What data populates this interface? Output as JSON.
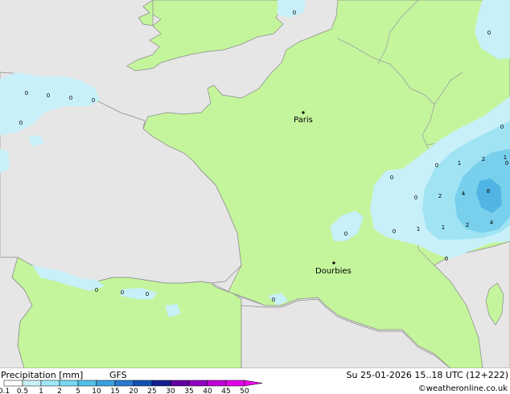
{
  "map": {
    "cities": [
      {
        "name": "Paris"
      },
      {
        "name": "Dourbies"
      }
    ],
    "precip_values": [
      "0",
      "0",
      "0",
      "0",
      "0",
      "0",
      "0",
      "0",
      "0",
      "0",
      "0",
      "0",
      "0",
      "0",
      "0",
      "0",
      "0",
      "1",
      "2",
      "1",
      "2",
      "4",
      "8",
      "1",
      "1",
      "2",
      "4",
      "0",
      "0"
    ]
  },
  "legend": {
    "title": "Precipitation [mm]",
    "model": "GFS",
    "datetime": "Su 25-01-2026 15..18 UTC (12+222)",
    "credit": "©weatheronline.co.uk",
    "ticks": [
      "0.1",
      "0.5",
      "1",
      "2",
      "5",
      "10",
      "15",
      "20",
      "25",
      "30",
      "35",
      "40",
      "45",
      "50"
    ],
    "colors": [
      "#ffffff",
      "#c8f0f8",
      "#a0e8f8",
      "#78d8f0",
      "#50c0e8",
      "#3aa0e0",
      "#2878d0",
      "#1050b0",
      "#102090",
      "#6000a0",
      "#9000c0",
      "#c000d8",
      "#e000e8",
      "#f000f0"
    ]
  },
  "colors": {
    "land": "#c4f59c",
    "sea": "#e6e6e6",
    "border": "#a0a0a0",
    "coast": "#888888",
    "precip_light": "#c8f0f8",
    "precip_mid": "#a0e4f4",
    "precip_heavy": "#78d0ec",
    "precip_max": "#50b4e4"
  }
}
